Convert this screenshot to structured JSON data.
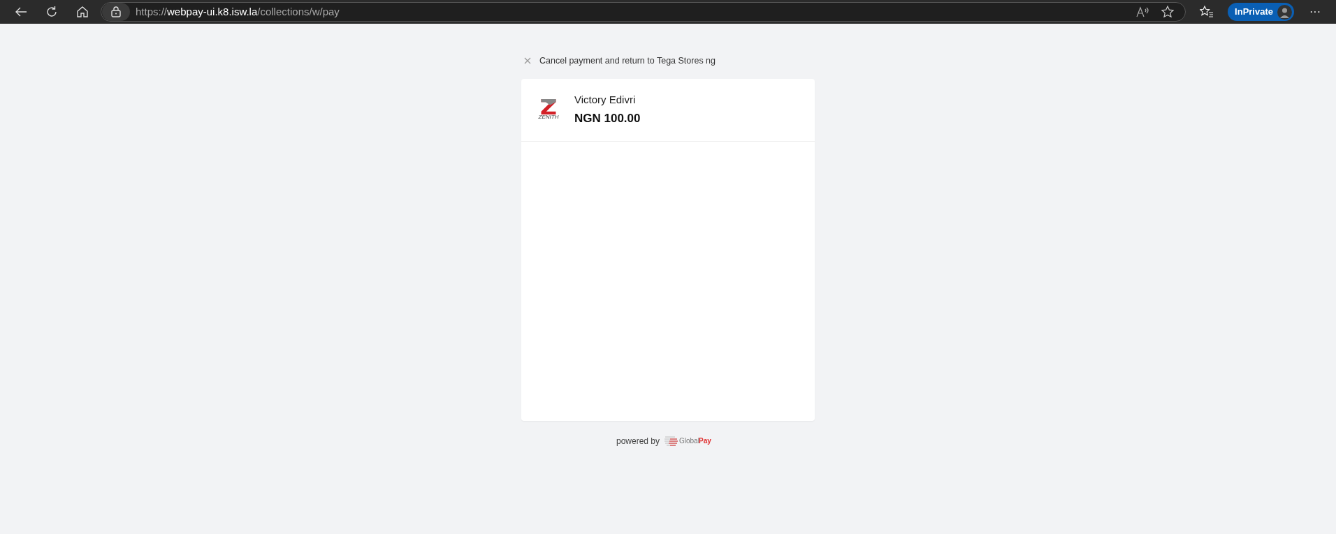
{
  "browser": {
    "url_scheme": "https://",
    "url_host": "webpay-ui.k8.isw.la",
    "url_path": "/collections/w/pay",
    "private_label": "InPrivate",
    "more": "···"
  },
  "cancel_link": "Cancel payment and return to Tega Stores ng",
  "merchant": {
    "logo_text": "ZENITH",
    "name": "Victory Edivri",
    "amount": "NGN 100.00"
  },
  "footer": {
    "powered_by": "powered by",
    "brand_1": "Global",
    "brand_2": "Pay"
  }
}
